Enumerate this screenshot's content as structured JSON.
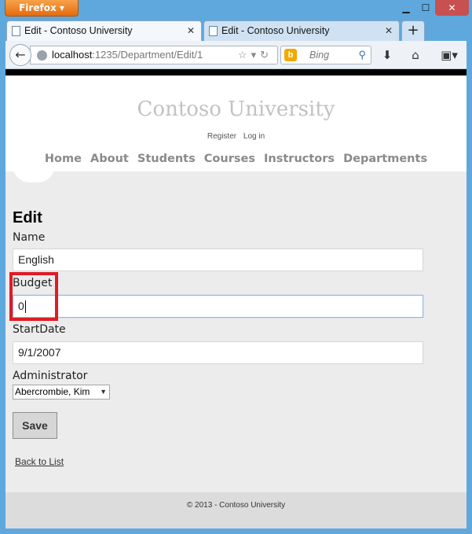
{
  "browser": {
    "menu_button": "Firefox",
    "tabs": [
      {
        "title": "Edit - Contoso University"
      },
      {
        "title": "Edit - Contoso University"
      }
    ],
    "url_host": "localhost",
    "url_rest": ":1235/Department/Edit/1",
    "search_placeholder": "Bing"
  },
  "site": {
    "title": "Contoso University",
    "auth_links": [
      "Register",
      "Log in"
    ],
    "nav": [
      "Home",
      "About",
      "Students",
      "Courses",
      "Instructors",
      "Departments"
    ]
  },
  "form": {
    "heading": "Edit",
    "name_label": "Name",
    "name_value": "English",
    "budget_label": "Budget",
    "budget_value": "0",
    "startdate_label": "StartDate",
    "startdate_value": "9/1/2007",
    "administrator_label": "Administrator",
    "administrator_value": "Abercrombie, Kim",
    "save_label": "Save",
    "back_link": "Back to List"
  },
  "footer": {
    "text": "© 2013 - Contoso University"
  },
  "colors": {
    "highlight": "#e01b24",
    "window_frame": "#5fa8dd",
    "firefox_button": "#e56b0c"
  }
}
